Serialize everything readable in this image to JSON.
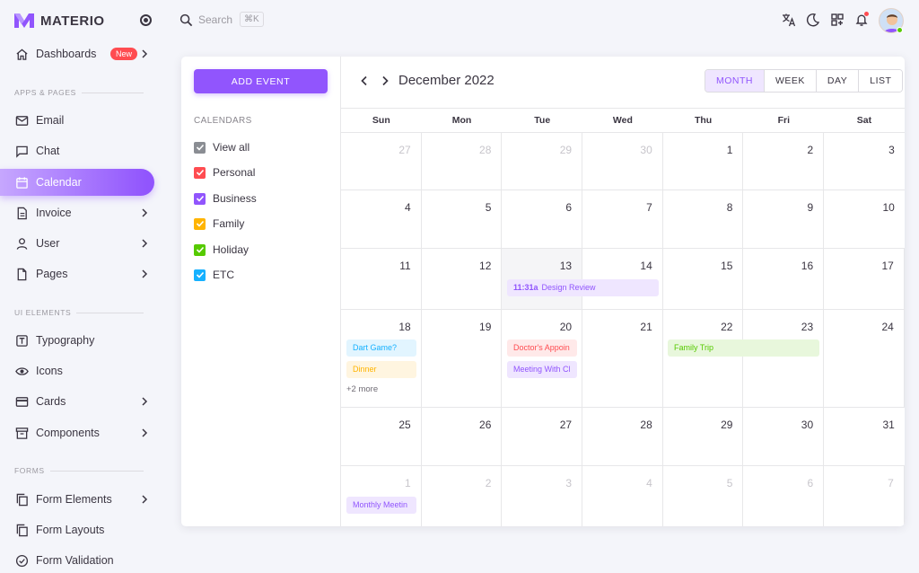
{
  "brand": {
    "name": "MATERIO"
  },
  "sidebar": {
    "items": [
      {
        "label": "Dashboards",
        "icon": "home-icon",
        "badge": "New",
        "chevron": true
      },
      {
        "label": "Email",
        "icon": "mail-icon"
      },
      {
        "label": "Chat",
        "icon": "chat-icon"
      },
      {
        "label": "Calendar",
        "icon": "calendar-icon",
        "active": true
      },
      {
        "label": "Invoice",
        "icon": "document-icon",
        "chevron": true
      },
      {
        "label": "User",
        "icon": "user-icon",
        "chevron": true
      },
      {
        "label": "Pages",
        "icon": "file-icon",
        "chevron": true
      },
      {
        "label": "Typography",
        "icon": "text-box-icon"
      },
      {
        "label": "Icons",
        "icon": "eye-icon"
      },
      {
        "label": "Cards",
        "icon": "credit-card-icon",
        "chevron": true
      },
      {
        "label": "Components",
        "icon": "archive-icon",
        "chevron": true
      },
      {
        "label": "Form Elements",
        "icon": "copy-icon",
        "chevron": true
      },
      {
        "label": "Form Layouts",
        "icon": "layout-icon"
      },
      {
        "label": "Form Validation",
        "icon": "check-circle-icon"
      }
    ],
    "sections": [
      "APPS & PAGES",
      "UI ELEMENTS",
      "FORMS"
    ]
  },
  "topbar": {
    "search_placeholder": "Search",
    "search_shortcut": "⌘K",
    "icons": [
      "translate-icon",
      "dark-mode-icon",
      "apps-grid-icon",
      "notification-icon"
    ]
  },
  "calendar": {
    "add_event_label": "ADD EVENT",
    "calendars_title": "CALENDARS",
    "filters": [
      {
        "label": "View all",
        "color": "#8a8d93"
      },
      {
        "label": "Personal",
        "color": "#ff4c51"
      },
      {
        "label": "Business",
        "color": "#9155fd"
      },
      {
        "label": "Family",
        "color": "#ffb400"
      },
      {
        "label": "Holiday",
        "color": "#56ca00"
      },
      {
        "label": "ETC",
        "color": "#16b1ff"
      }
    ],
    "month_title": "December 2022",
    "views": [
      "MONTH",
      "WEEK",
      "DAY",
      "LIST"
    ],
    "active_view": "MONTH",
    "weekdays": [
      "Sun",
      "Mon",
      "Tue",
      "Wed",
      "Thu",
      "Fri",
      "Sat"
    ],
    "weeks": [
      [
        "27",
        "28",
        "29",
        "30",
        "1",
        "2",
        "3"
      ],
      [
        "4",
        "5",
        "6",
        "7",
        "8",
        "9",
        "10"
      ],
      [
        "11",
        "12",
        "13",
        "14",
        "15",
        "16",
        "17"
      ],
      [
        "18",
        "19",
        "20",
        "21",
        "22",
        "23",
        "24"
      ],
      [
        "25",
        "26",
        "27",
        "28",
        "29",
        "30",
        "31"
      ],
      [
        "1",
        "2",
        "3",
        "4",
        "5",
        "6",
        "7"
      ]
    ],
    "events": {
      "design_review": {
        "time": "11:31a",
        "title": "Design Review"
      },
      "dart_game": {
        "title": "Dart Game?"
      },
      "dinner": {
        "title": "Dinner"
      },
      "more": "+2 more",
      "doctors": {
        "title": "Doctor's Appoin"
      },
      "meeting_client": {
        "title": "Meeting With Cl"
      },
      "family_trip": {
        "title": "Family Trip"
      },
      "monthly_meeting": {
        "title": "Monthly Meetin"
      }
    }
  }
}
